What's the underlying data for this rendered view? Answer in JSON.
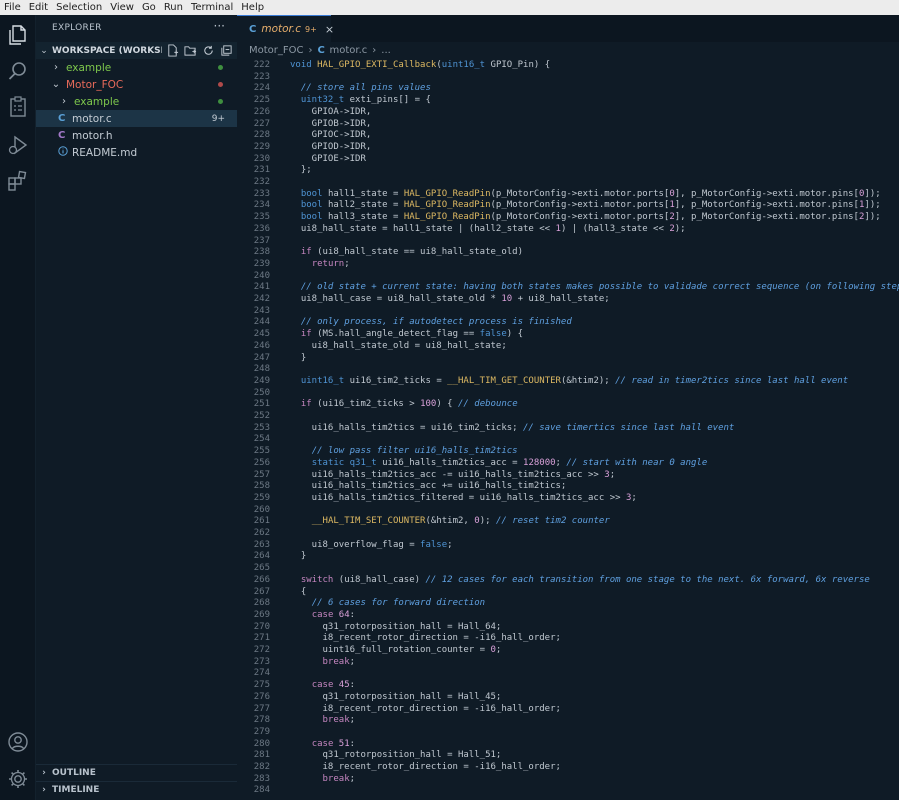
{
  "menu": [
    "File",
    "Edit",
    "Selection",
    "View",
    "Go",
    "Run",
    "Terminal",
    "Help"
  ],
  "sidebar": {
    "title": "EXPLORER",
    "more": "···",
    "workspace_label": "WORKSPACE (WORKSP...",
    "tree": [
      {
        "label": "example",
        "type": "folder",
        "expanded": false,
        "depth": 0,
        "color": "#7ec84c",
        "dot": "#3f8f3f"
      },
      {
        "label": "Motor_FOC",
        "type": "folder",
        "expanded": true,
        "depth": 0,
        "color": "#e86a5a",
        "dot": "#b04a4a"
      },
      {
        "label": "example",
        "type": "folder",
        "expanded": false,
        "depth": 1,
        "color": "#7ec84c",
        "dot": "#3f8f3f"
      },
      {
        "label": "motor.c",
        "type": "c",
        "depth": 1,
        "color": "#c4ccd4",
        "badge": "9+",
        "selected": true
      },
      {
        "label": "motor.h",
        "type": "h",
        "depth": 1,
        "color": "#c4ccd4"
      },
      {
        "label": "README.md",
        "type": "info",
        "depth": 1,
        "color": "#c4ccd4"
      }
    ],
    "outline_label": "OUTLINE",
    "timeline_label": "TIMELINE"
  },
  "tab": {
    "icon": "C",
    "label": "motor.c",
    "badge": "9+",
    "close": "×"
  },
  "breadcrumb": {
    "folder": "Motor_FOC",
    "icon": "C",
    "file": "motor.c",
    "more": "..."
  },
  "code": [
    {
      "n": "222",
      "t": "void HAL_GPIO_EXTI_Callback(uint16_t GPIO_Pin) {"
    },
    {
      "n": "223",
      "t": ""
    },
    {
      "n": "224",
      "t": "  // store all pins values"
    },
    {
      "n": "225",
      "t": "  uint32_t exti_pins[] = {"
    },
    {
      "n": "226",
      "t": "    GPIOA->IDR,"
    },
    {
      "n": "227",
      "t": "    GPIOB->IDR,"
    },
    {
      "n": "228",
      "t": "    GPIOC->IDR,"
    },
    {
      "n": "229",
      "t": "    GPIOD->IDR,"
    },
    {
      "n": "230",
      "t": "    GPIOE->IDR"
    },
    {
      "n": "231",
      "t": "  };"
    },
    {
      "n": "232",
      "t": ""
    },
    {
      "n": "233",
      "t": "  bool hall1_state = HAL_GPIO_ReadPin(p_MotorConfig->exti.motor.ports[0], p_MotorConfig->exti.motor.pins[0]);"
    },
    {
      "n": "234",
      "t": "  bool hall2_state = HAL_GPIO_ReadPin(p_MotorConfig->exti.motor.ports[1], p_MotorConfig->exti.motor.pins[1]);"
    },
    {
      "n": "235",
      "t": "  bool hall3_state = HAL_GPIO_ReadPin(p_MotorConfig->exti.motor.ports[2], p_MotorConfig->exti.motor.pins[2]);"
    },
    {
      "n": "236",
      "t": "  ui8_hall_state = hall1_state | (hall2_state << 1) | (hall3_state << 2);"
    },
    {
      "n": "237",
      "t": ""
    },
    {
      "n": "238",
      "t": "  if (ui8_hall_state == ui8_hall_state_old)"
    },
    {
      "n": "239",
      "t": "    return;"
    },
    {
      "n": "240",
      "t": ""
    },
    {
      "n": "241",
      "t": "  // old state + current state: having both states makes possible to validade correct sequence (on following steps)"
    },
    {
      "n": "242",
      "t": "  ui8_hall_case = ui8_hall_state_old * 10 + ui8_hall_state;"
    },
    {
      "n": "243",
      "t": ""
    },
    {
      "n": "244",
      "t": "  // only process, if autodetect process is finished"
    },
    {
      "n": "245",
      "t": "  if (MS.hall_angle_detect_flag == false) {"
    },
    {
      "n": "246",
      "t": "    ui8_hall_state_old = ui8_hall_state;"
    },
    {
      "n": "247",
      "t": "  }"
    },
    {
      "n": "248",
      "t": ""
    },
    {
      "n": "249",
      "t": "  uint16_t ui16_tim2_ticks = __HAL_TIM_GET_COUNTER(&htim2); // read in timer2tics since last hall event"
    },
    {
      "n": "250",
      "t": ""
    },
    {
      "n": "251",
      "t": "  if (ui16_tim2_ticks > 100) { // debounce"
    },
    {
      "n": "252",
      "t": ""
    },
    {
      "n": "253",
      "t": "    ui16_halls_tim2tics = ui16_tim2_ticks; // save timertics since last hall event"
    },
    {
      "n": "254",
      "t": ""
    },
    {
      "n": "255",
      "t": "    // low pass filter ui16_halls_tim2tics"
    },
    {
      "n": "256",
      "t": "    static q31_t ui16_halls_tim2tics_acc = 128000; // start with near 0 angle"
    },
    {
      "n": "257",
      "t": "    ui16_halls_tim2tics_acc -= ui16_halls_tim2tics_acc >> 3;"
    },
    {
      "n": "258",
      "t": "    ui16_halls_tim2tics_acc += ui16_halls_tim2tics;"
    },
    {
      "n": "259",
      "t": "    ui16_halls_tim2tics_filtered = ui16_halls_tim2tics_acc >> 3;"
    },
    {
      "n": "260",
      "t": ""
    },
    {
      "n": "261",
      "t": "    __HAL_TIM_SET_COUNTER(&htim2, 0); // reset tim2 counter"
    },
    {
      "n": "262",
      "t": ""
    },
    {
      "n": "263",
      "t": "    ui8_overflow_flag = false;"
    },
    {
      "n": "264",
      "t": "  }"
    },
    {
      "n": "265",
      "t": ""
    },
    {
      "n": "266",
      "t": "  switch (ui8_hall_case) // 12 cases for each transition from one stage to the next. 6x forward, 6x reverse"
    },
    {
      "n": "267",
      "t": "  {"
    },
    {
      "n": "268",
      "t": "    // 6 cases for forward direction"
    },
    {
      "n": "269",
      "t": "    case 64:"
    },
    {
      "n": "270",
      "t": "      q31_rotorposition_hall = Hall_64;"
    },
    {
      "n": "271",
      "t": "      i8_recent_rotor_direction = -i16_hall_order;"
    },
    {
      "n": "272",
      "t": "      uint16_full_rotation_counter = 0;"
    },
    {
      "n": "273",
      "t": "      break;"
    },
    {
      "n": "274",
      "t": ""
    },
    {
      "n": "275",
      "t": "    case 45:"
    },
    {
      "n": "276",
      "t": "      q31_rotorposition_hall = Hall_45;"
    },
    {
      "n": "277",
      "t": "      i8_recent_rotor_direction = -i16_hall_order;"
    },
    {
      "n": "278",
      "t": "      break;"
    },
    {
      "n": "279",
      "t": ""
    },
    {
      "n": "280",
      "t": "    case 51:"
    },
    {
      "n": "281",
      "t": "      q31_rotorposition_hall = Hall_51;"
    },
    {
      "n": "282",
      "t": "      i8_recent_rotor_direction = -i16_hall_order;"
    },
    {
      "n": "283",
      "t": "      break;"
    },
    {
      "n": "284",
      "t": ""
    }
  ],
  "colors": {
    "keyword": "#4f94d4",
    "control": "#c586c0",
    "function": "#dcb862",
    "comment": "#5fa0e0",
    "number": "#d8a0d8",
    "accent": "#3a7bd5"
  }
}
